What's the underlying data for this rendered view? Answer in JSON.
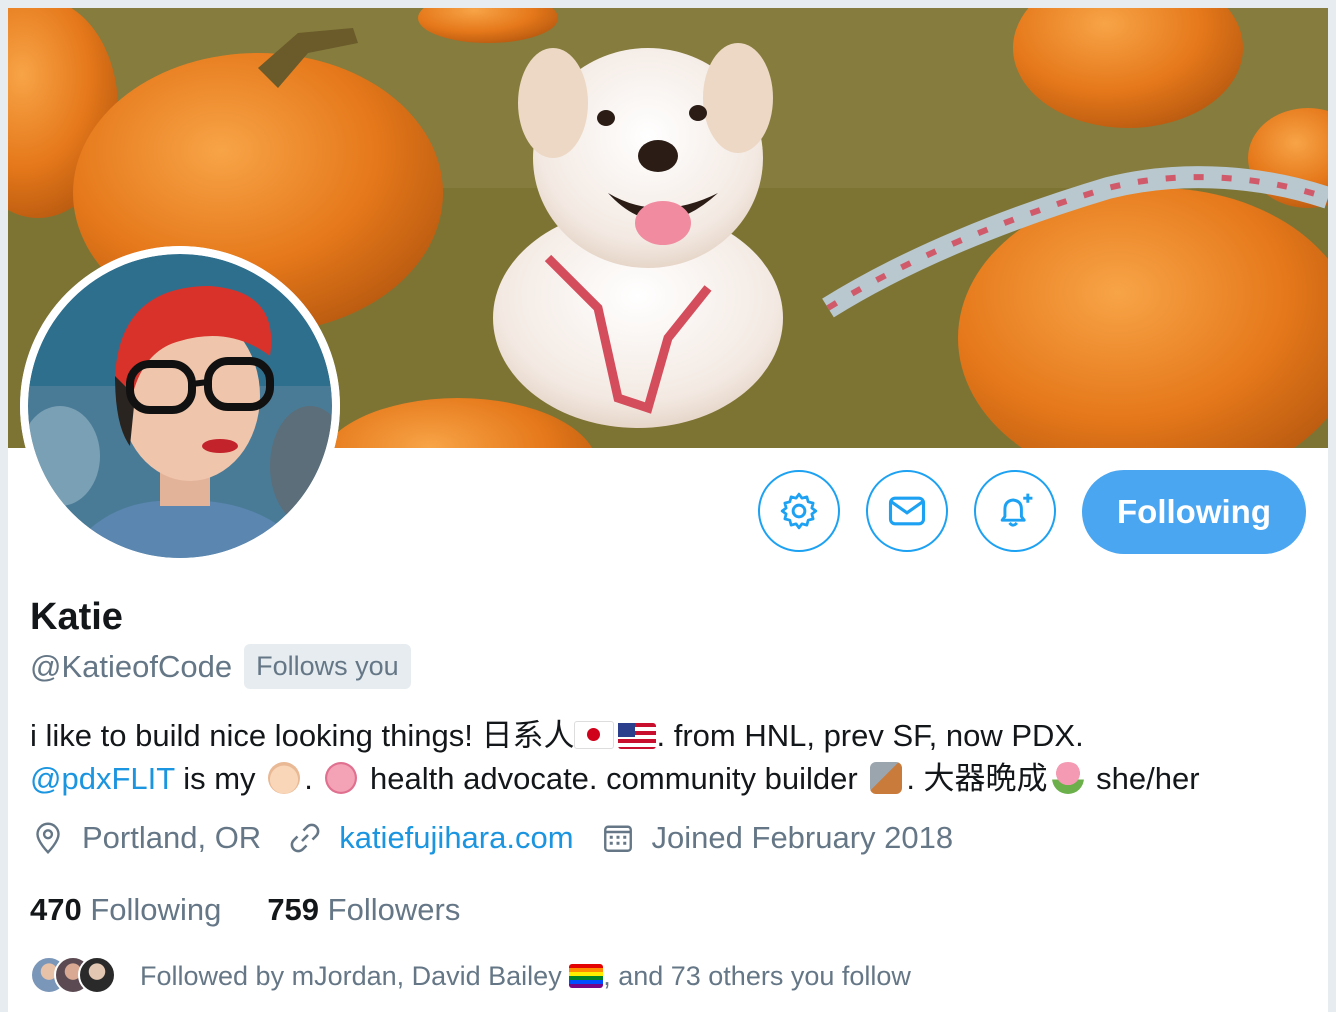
{
  "profile": {
    "name": "Katie",
    "handle": "@KatieofCode",
    "follows_you": "Follows you"
  },
  "actions": {
    "following_label": "Following",
    "settings_icon": "gear-icon",
    "message_icon": "envelope-icon",
    "notifications_icon": "bell-plus-icon"
  },
  "bio": {
    "line1_text": "i like to build nice looking things! 日系人",
    "line1_tail": ". from HNL, prev SF, now PDX.",
    "mention": "@pdxFLIT",
    "line2_a": " is my ",
    "line2_b": ". ",
    "line2_c": " health advocate. community builder ",
    "line2_d": ". 大器晩成",
    "line2_e": " she/her"
  },
  "meta": {
    "location": "Portland, OR",
    "website": "katiefujihara.com",
    "joined": "Joined February 2018"
  },
  "stats": {
    "following_count": "470",
    "following_label": "Following",
    "followers_count": "759",
    "followers_label": "Followers"
  },
  "followed_by": {
    "prefix": "Followed by mJordan, David Bailey ",
    "suffix": ", and 73 others you follow"
  },
  "colors": {
    "accent": "#1da1f2",
    "following_button": "#4aa6f0",
    "link": "#1b95e0",
    "muted": "#657786"
  }
}
